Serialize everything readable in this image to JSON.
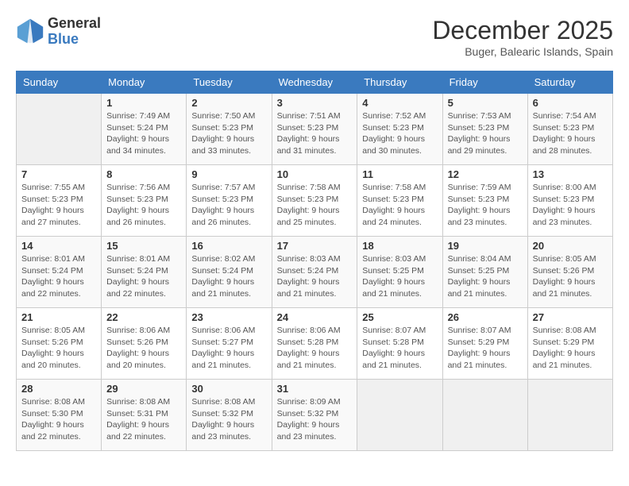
{
  "header": {
    "logo_line1": "General",
    "logo_line2": "Blue",
    "month": "December 2025",
    "location": "Buger, Balearic Islands, Spain"
  },
  "days_of_week": [
    "Sunday",
    "Monday",
    "Tuesday",
    "Wednesday",
    "Thursday",
    "Friday",
    "Saturday"
  ],
  "weeks": [
    [
      {
        "day": "",
        "info": ""
      },
      {
        "day": "1",
        "info": "Sunrise: 7:49 AM\nSunset: 5:24 PM\nDaylight: 9 hours\nand 34 minutes."
      },
      {
        "day": "2",
        "info": "Sunrise: 7:50 AM\nSunset: 5:23 PM\nDaylight: 9 hours\nand 33 minutes."
      },
      {
        "day": "3",
        "info": "Sunrise: 7:51 AM\nSunset: 5:23 PM\nDaylight: 9 hours\nand 31 minutes."
      },
      {
        "day": "4",
        "info": "Sunrise: 7:52 AM\nSunset: 5:23 PM\nDaylight: 9 hours\nand 30 minutes."
      },
      {
        "day": "5",
        "info": "Sunrise: 7:53 AM\nSunset: 5:23 PM\nDaylight: 9 hours\nand 29 minutes."
      },
      {
        "day": "6",
        "info": "Sunrise: 7:54 AM\nSunset: 5:23 PM\nDaylight: 9 hours\nand 28 minutes."
      }
    ],
    [
      {
        "day": "7",
        "info": "Sunrise: 7:55 AM\nSunset: 5:23 PM\nDaylight: 9 hours\nand 27 minutes."
      },
      {
        "day": "8",
        "info": "Sunrise: 7:56 AM\nSunset: 5:23 PM\nDaylight: 9 hours\nand 26 minutes."
      },
      {
        "day": "9",
        "info": "Sunrise: 7:57 AM\nSunset: 5:23 PM\nDaylight: 9 hours\nand 26 minutes."
      },
      {
        "day": "10",
        "info": "Sunrise: 7:58 AM\nSunset: 5:23 PM\nDaylight: 9 hours\nand 25 minutes."
      },
      {
        "day": "11",
        "info": "Sunrise: 7:58 AM\nSunset: 5:23 PM\nDaylight: 9 hours\nand 24 minutes."
      },
      {
        "day": "12",
        "info": "Sunrise: 7:59 AM\nSunset: 5:23 PM\nDaylight: 9 hours\nand 23 minutes."
      },
      {
        "day": "13",
        "info": "Sunrise: 8:00 AM\nSunset: 5:23 PM\nDaylight: 9 hours\nand 23 minutes."
      }
    ],
    [
      {
        "day": "14",
        "info": "Sunrise: 8:01 AM\nSunset: 5:24 PM\nDaylight: 9 hours\nand 22 minutes."
      },
      {
        "day": "15",
        "info": "Sunrise: 8:01 AM\nSunset: 5:24 PM\nDaylight: 9 hours\nand 22 minutes."
      },
      {
        "day": "16",
        "info": "Sunrise: 8:02 AM\nSunset: 5:24 PM\nDaylight: 9 hours\nand 21 minutes."
      },
      {
        "day": "17",
        "info": "Sunrise: 8:03 AM\nSunset: 5:24 PM\nDaylight: 9 hours\nand 21 minutes."
      },
      {
        "day": "18",
        "info": "Sunrise: 8:03 AM\nSunset: 5:25 PM\nDaylight: 9 hours\nand 21 minutes."
      },
      {
        "day": "19",
        "info": "Sunrise: 8:04 AM\nSunset: 5:25 PM\nDaylight: 9 hours\nand 21 minutes."
      },
      {
        "day": "20",
        "info": "Sunrise: 8:05 AM\nSunset: 5:26 PM\nDaylight: 9 hours\nand 21 minutes."
      }
    ],
    [
      {
        "day": "21",
        "info": "Sunrise: 8:05 AM\nSunset: 5:26 PM\nDaylight: 9 hours\nand 20 minutes."
      },
      {
        "day": "22",
        "info": "Sunrise: 8:06 AM\nSunset: 5:26 PM\nDaylight: 9 hours\nand 20 minutes."
      },
      {
        "day": "23",
        "info": "Sunrise: 8:06 AM\nSunset: 5:27 PM\nDaylight: 9 hours\nand 21 minutes."
      },
      {
        "day": "24",
        "info": "Sunrise: 8:06 AM\nSunset: 5:28 PM\nDaylight: 9 hours\nand 21 minutes."
      },
      {
        "day": "25",
        "info": "Sunrise: 8:07 AM\nSunset: 5:28 PM\nDaylight: 9 hours\nand 21 minutes."
      },
      {
        "day": "26",
        "info": "Sunrise: 8:07 AM\nSunset: 5:29 PM\nDaylight: 9 hours\nand 21 minutes."
      },
      {
        "day": "27",
        "info": "Sunrise: 8:08 AM\nSunset: 5:29 PM\nDaylight: 9 hours\nand 21 minutes."
      }
    ],
    [
      {
        "day": "28",
        "info": "Sunrise: 8:08 AM\nSunset: 5:30 PM\nDaylight: 9 hours\nand 22 minutes."
      },
      {
        "day": "29",
        "info": "Sunrise: 8:08 AM\nSunset: 5:31 PM\nDaylight: 9 hours\nand 22 minutes."
      },
      {
        "day": "30",
        "info": "Sunrise: 8:08 AM\nSunset: 5:32 PM\nDaylight: 9 hours\nand 23 minutes."
      },
      {
        "day": "31",
        "info": "Sunrise: 8:09 AM\nSunset: 5:32 PM\nDaylight: 9 hours\nand 23 minutes."
      },
      {
        "day": "",
        "info": ""
      },
      {
        "day": "",
        "info": ""
      },
      {
        "day": "",
        "info": ""
      }
    ]
  ]
}
